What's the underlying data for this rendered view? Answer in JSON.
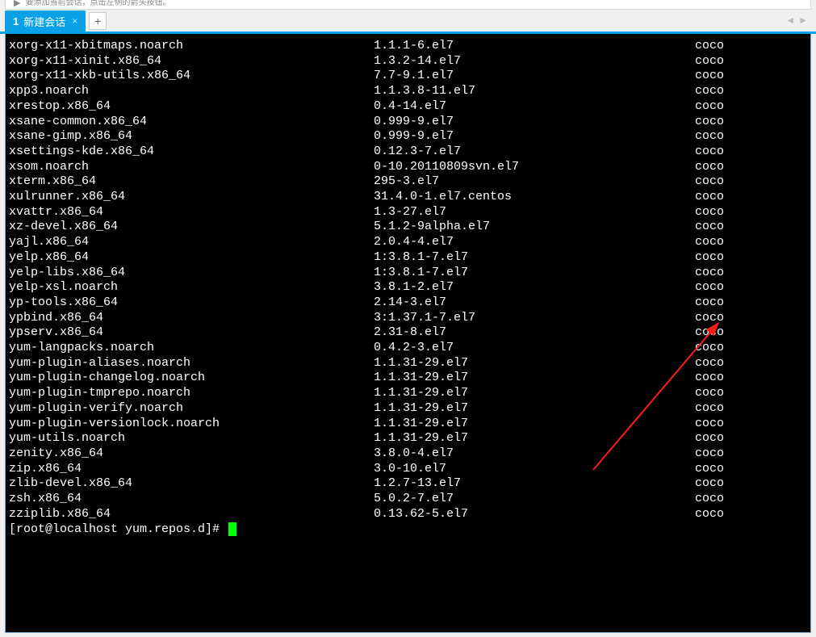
{
  "hint_text": "要添加当前会话，点击左侧的箭头按钮。",
  "tab": {
    "num": "1",
    "label": "新建会话",
    "close": "×"
  },
  "add_tab": "+",
  "nav": {
    "left": "◄",
    "right": "►"
  },
  "packages": [
    {
      "name": "xorg-x11-xbitmaps.noarch",
      "ver": "1.1.1-6.el7",
      "repo": "coco"
    },
    {
      "name": "xorg-x11-xinit.x86_64",
      "ver": "1.3.2-14.el7",
      "repo": "coco"
    },
    {
      "name": "xorg-x11-xkb-utils.x86_64",
      "ver": "7.7-9.1.el7",
      "repo": "coco"
    },
    {
      "name": "xpp3.noarch",
      "ver": "1.1.3.8-11.el7",
      "repo": "coco"
    },
    {
      "name": "xrestop.x86_64",
      "ver": "0.4-14.el7",
      "repo": "coco"
    },
    {
      "name": "xsane-common.x86_64",
      "ver": "0.999-9.el7",
      "repo": "coco"
    },
    {
      "name": "xsane-gimp.x86_64",
      "ver": "0.999-9.el7",
      "repo": "coco"
    },
    {
      "name": "xsettings-kde.x86_64",
      "ver": "0.12.3-7.el7",
      "repo": "coco"
    },
    {
      "name": "xsom.noarch",
      "ver": "0-10.20110809svn.el7",
      "repo": "coco"
    },
    {
      "name": "xterm.x86_64",
      "ver": "295-3.el7",
      "repo": "coco"
    },
    {
      "name": "xulrunner.x86_64",
      "ver": "31.4.0-1.el7.centos",
      "repo": "coco"
    },
    {
      "name": "xvattr.x86_64",
      "ver": "1.3-27.el7",
      "repo": "coco"
    },
    {
      "name": "xz-devel.x86_64",
      "ver": "5.1.2-9alpha.el7",
      "repo": "coco"
    },
    {
      "name": "yajl.x86_64",
      "ver": "2.0.4-4.el7",
      "repo": "coco"
    },
    {
      "name": "yelp.x86_64",
      "ver": "1:3.8.1-7.el7",
      "repo": "coco"
    },
    {
      "name": "yelp-libs.x86_64",
      "ver": "1:3.8.1-7.el7",
      "repo": "coco"
    },
    {
      "name": "yelp-xsl.noarch",
      "ver": "3.8.1-2.el7",
      "repo": "coco"
    },
    {
      "name": "yp-tools.x86_64",
      "ver": "2.14-3.el7",
      "repo": "coco"
    },
    {
      "name": "ypbind.x86_64",
      "ver": "3:1.37.1-7.el7",
      "repo": "coco"
    },
    {
      "name": "ypserv.x86_64",
      "ver": "2.31-8.el7",
      "repo": "coco"
    },
    {
      "name": "yum-langpacks.noarch",
      "ver": "0.4.2-3.el7",
      "repo": "coco"
    },
    {
      "name": "yum-plugin-aliases.noarch",
      "ver": "1.1.31-29.el7",
      "repo": "coco"
    },
    {
      "name": "yum-plugin-changelog.noarch",
      "ver": "1.1.31-29.el7",
      "repo": "coco"
    },
    {
      "name": "yum-plugin-tmprepo.noarch",
      "ver": "1.1.31-29.el7",
      "repo": "coco"
    },
    {
      "name": "yum-plugin-verify.noarch",
      "ver": "1.1.31-29.el7",
      "repo": "coco"
    },
    {
      "name": "yum-plugin-versionlock.noarch",
      "ver": "1.1.31-29.el7",
      "repo": "coco"
    },
    {
      "name": "yum-utils.noarch",
      "ver": "1.1.31-29.el7",
      "repo": "coco"
    },
    {
      "name": "zenity.x86_64",
      "ver": "3.8.0-4.el7",
      "repo": "coco"
    },
    {
      "name": "zip.x86_64",
      "ver": "3.0-10.el7",
      "repo": "coco"
    },
    {
      "name": "zlib-devel.x86_64",
      "ver": "1.2.7-13.el7",
      "repo": "coco"
    },
    {
      "name": "zsh.x86_64",
      "ver": "5.0.2-7.el7",
      "repo": "coco"
    },
    {
      "name": "zziplib.x86_64",
      "ver": "0.13.62-5.el7",
      "repo": "coco"
    }
  ],
  "prompt": "[root@localhost yum.repos.d]# "
}
